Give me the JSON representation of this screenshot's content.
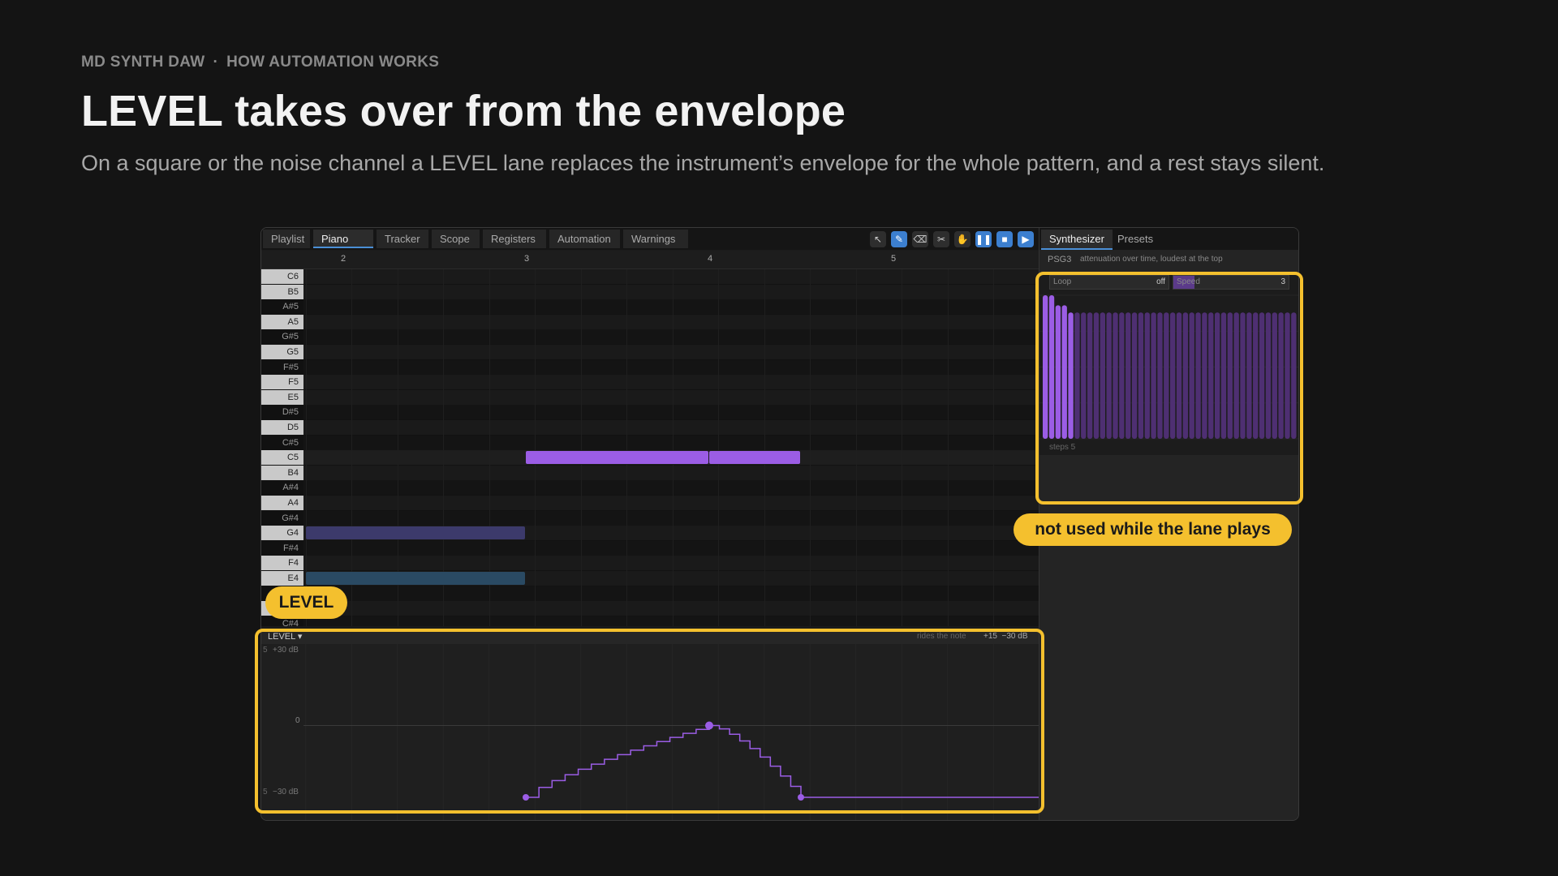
{
  "header": {
    "kicker_app": "MD SYNTH DAW",
    "kicker_sep": "·",
    "kicker_topic": "HOW AUTOMATION WORKS",
    "title": "LEVEL takes over from the envelope",
    "subtitle": "On a square or the noise channel a LEVEL lane replaces the instrument’s envelope for the whole pattern, and a rest stays silent."
  },
  "tabs": [
    "Playlist",
    "Piano roll",
    "Tracker",
    "Scope",
    "Registers",
    "Automation",
    "Warnings"
  ],
  "active_tab": "Piano roll",
  "toolbar": {
    "icons": [
      "pointer-icon",
      "pencil-icon",
      "eraser-icon",
      "cut-icon",
      "hand-icon",
      "pause-icon",
      "stop-icon",
      "play-icon"
    ]
  },
  "ruler": [
    "2",
    "3",
    "4",
    "5"
  ],
  "keys": [
    "C6",
    "B5",
    "A#5",
    "A5",
    "G#5",
    "G5",
    "F#5",
    "F5",
    "E5",
    "D#5",
    "D5",
    "C#5",
    "C5",
    "B4",
    "A#4",
    "A4",
    "G#4",
    "G4",
    "F#4",
    "F4",
    "E4",
    "D#4",
    "D4",
    "C#4"
  ],
  "notes": [
    {
      "pitch": "C5",
      "start_bar": 3.0,
      "end_bar": 4.0,
      "color": "#9b5de5"
    },
    {
      "pitch": "C5",
      "start_bar": 4.0,
      "end_bar": 4.5,
      "color": "#9b5de5"
    },
    {
      "pitch": "G4",
      "start_bar": 1.8,
      "end_bar": 3.0,
      "color": "#3c3a6b"
    },
    {
      "pitch": "E4",
      "start_bar": 1.8,
      "end_bar": 3.0,
      "color": "#2a4a63"
    }
  ],
  "lane": {
    "label": "LEVEL ▾",
    "hint": "rides the note",
    "range": "+15  −30 dB",
    "top_label": "+30 dB",
    "mid_label": "0",
    "bottom_label": "−30 dB",
    "top_prefix": "5",
    "bottom_prefix": "5",
    "ymin_db": -30,
    "ymax_db": 30,
    "points": [
      {
        "bar": 3.0,
        "db": -30
      },
      {
        "bar": 4.0,
        "db": 0
      },
      {
        "bar": 4.5,
        "db": -30
      },
      {
        "bar": 5.8,
        "db": -30
      }
    ],
    "curve_color": "#9b5de5"
  },
  "side": {
    "tabs": [
      "Synthesizer",
      "Presets"
    ],
    "active_tab": "Synthesizer",
    "channel": "PSG3",
    "caption": "attenuation over time, loudest at the top",
    "loop_label": "Loop",
    "loop_value": "off",
    "speed_label": "Speed",
    "speed_value": "3",
    "steps_label": "steps 5",
    "envelope_levels": [
      1.0,
      1.0,
      0.93,
      0.93,
      0.88,
      0.88,
      0.88,
      0.88,
      0.88,
      0.88,
      0.88,
      0.88,
      0.88,
      0.88,
      0.88,
      0.88,
      0.88,
      0.88,
      0.88,
      0.88,
      0.88,
      0.88,
      0.88,
      0.88,
      0.88,
      0.88,
      0.88,
      0.88,
      0.88,
      0.88,
      0.88,
      0.88,
      0.88,
      0.88,
      0.88,
      0.88,
      0.88,
      0.88,
      0.88,
      0.88
    ],
    "active_steps": 5
  },
  "callouts": {
    "level": "LEVEL",
    "envelope_note": "not used while the lane plays"
  },
  "colors": {
    "highlight": "#f4c02e",
    "accent": "#9b5de5",
    "tab_underline": "#4a8fd6"
  }
}
